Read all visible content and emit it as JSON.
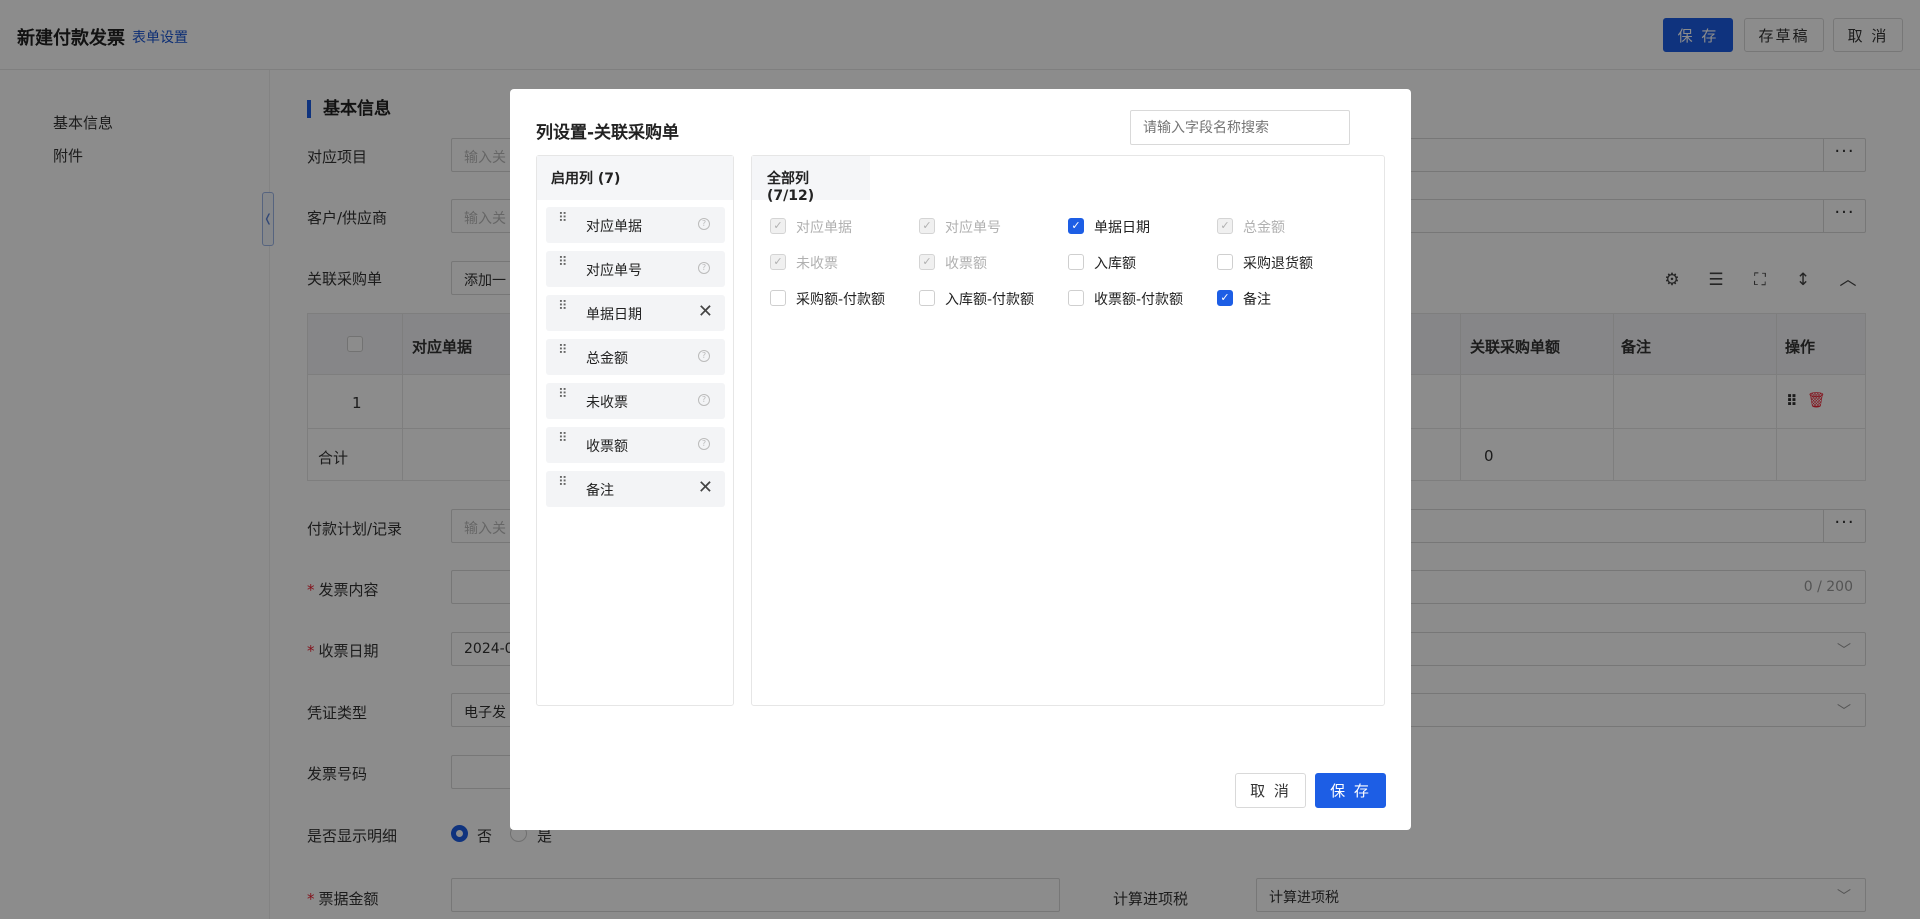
{
  "header": {
    "title": "新建付款发票",
    "settings_link": "表单设置",
    "save_label": "保 存",
    "draft_label": "存草稿",
    "cancel_label": "取 消"
  },
  "sidebar": {
    "items": [
      {
        "label": "基本信息"
      },
      {
        "label": "附件"
      }
    ]
  },
  "form": {
    "section_title": "基本信息",
    "fields": {
      "project": {
        "label": "对应项目",
        "placeholder": "输入关"
      },
      "customer": {
        "label": "客户/供应商",
        "placeholder": "输入关"
      },
      "po": {
        "label": "关联采购单",
        "add_label": "添加一"
      },
      "plan": {
        "label": "付款计划/记录",
        "placeholder": "输入关"
      },
      "content": {
        "label": "发票内容",
        "counter": "0 / 200"
      },
      "date": {
        "label": "收票日期",
        "value": "2024-0"
      },
      "voucher": {
        "label": "凭证类型",
        "value": "电子发"
      },
      "invoice_no": {
        "label": "发票号码"
      },
      "show_detail": {
        "label": "是否显示明细",
        "opt_no": "否",
        "opt_yes": "是"
      },
      "amount": {
        "label": "票据金额"
      },
      "tax": {
        "label": "计算进项税",
        "value": "计算进项税"
      }
    },
    "table": {
      "headers": {
        "doc": "对应单据",
        "po_amount": "关联采购单额",
        "remark": "备注",
        "ops": "操作"
      },
      "row_index": "1",
      "total_label": "合计",
      "total_value": "0"
    }
  },
  "modal": {
    "title": "列设置-关联采购单",
    "search_placeholder": "请输入字段名称搜索",
    "enabled_title": "启用列 (7)",
    "enabled": [
      {
        "label": "对应单据",
        "removable": false
      },
      {
        "label": "对应单号",
        "removable": false
      },
      {
        "label": "单据日期",
        "removable": true
      },
      {
        "label": "总金额",
        "removable": false
      },
      {
        "label": "未收票",
        "removable": false
      },
      {
        "label": "收票额",
        "removable": false
      },
      {
        "label": "备注",
        "removable": true
      }
    ],
    "all_title": "全部列 (7/12)",
    "options": [
      {
        "label": "对应单据",
        "state": "disabled-checked"
      },
      {
        "label": "对应单号",
        "state": "disabled-checked"
      },
      {
        "label": "单据日期",
        "state": "checked"
      },
      {
        "label": "总金额",
        "state": "disabled-checked"
      },
      {
        "label": "未收票",
        "state": "disabled-checked"
      },
      {
        "label": "收票额",
        "state": "disabled-checked"
      },
      {
        "label": "入库额",
        "state": "unchecked"
      },
      {
        "label": "采购退货额",
        "state": "unchecked"
      },
      {
        "label": "采购额-付款额",
        "state": "unchecked"
      },
      {
        "label": "入库额-付款额",
        "state": "unchecked"
      },
      {
        "label": "收票额-付款额",
        "state": "unchecked"
      },
      {
        "label": "备注",
        "state": "checked"
      }
    ],
    "cancel_label": "取 消",
    "save_label": "保 存"
  }
}
